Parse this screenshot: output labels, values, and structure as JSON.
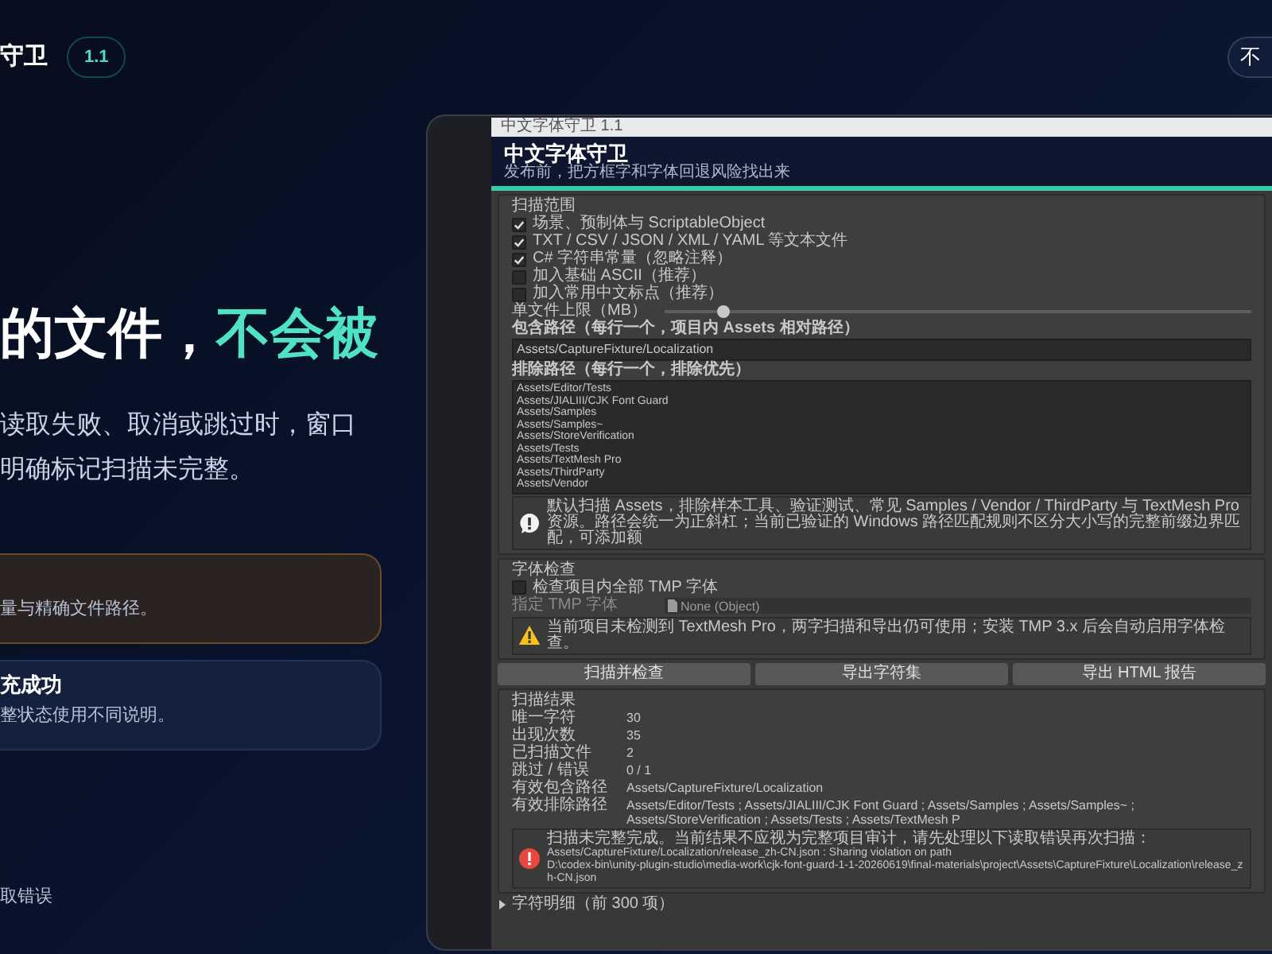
{
  "brand": {
    "title": "守卫",
    "version": "1.1"
  },
  "nav_button": {
    "label": "不"
  },
  "hero": {
    "heading_white": "的文件，",
    "heading_accent": "不会被",
    "lines": [
      "读取失败、取消或跳过时，窗口",
      "明确标记扫描未完整。"
    ]
  },
  "cards": [
    {
      "kind": "warning",
      "text": "量与精确文件路径。"
    },
    {
      "kind": "success",
      "title": "充成功",
      "text": "整状态使用不同说明。"
    }
  ],
  "footer_text": "取错误",
  "app": {
    "window_title": "中文字体守卫 1.1",
    "header": {
      "title": "中文字体守卫",
      "subtitle": "发布前，把方框字和字体回退风险找出来"
    },
    "scan_scope": {
      "title": "扫描范围",
      "options": [
        {
          "label": "场景、预制体与 ScriptableObject",
          "checked": true
        },
        {
          "label": "TXT / CSV / JSON / XML / YAML 等文本文件",
          "checked": true
        },
        {
          "label": "C# 字符串常量（忽略注释）",
          "checked": true
        },
        {
          "label": "加入基础 ASCII（推荐）",
          "checked": false
        },
        {
          "label": "加入常用中文标点（推荐）",
          "checked": false
        }
      ],
      "slider": {
        "label": "单文件上限（MB）",
        "level": 0.1
      },
      "include": {
        "label": "包含路径（每行一个，项目内 Assets 相对路径）",
        "lines": [
          "Assets/CaptureFixture/Localization"
        ]
      },
      "exclude": {
        "label": "排除路径（每行一个，排除优先）",
        "lines": [
          "Assets/Editor/Tests",
          "Assets/JIALIII/CJK Font Guard",
          "Assets/Samples",
          "Assets/Samples~",
          "Assets/StoreVerification",
          "Assets/Tests",
          "Assets/TextMesh Pro",
          "Assets/ThirdParty",
          "Assets/Vendor"
        ]
      },
      "note": {
        "kind": "info",
        "text": "默认扫描 Assets，排除样本工具、验证测试、常见 Samples / Vendor / ThirdParty 与 TextMesh Pro 资源。路径会统一为正斜杠；当前已验证的 Windows 路径匹配规则不区分大小写的完整前缀边界匹配，可添加额"
      }
    },
    "font_check": {
      "title": "字体检查",
      "option": {
        "label": "检查项目内全部 TMP 字体",
        "checked": false
      },
      "field": {
        "label": "指定 TMP 字体",
        "value": "None (Object)",
        "disabled": true
      },
      "note": {
        "kind": "warning",
        "text": "当前项目未检测到 TextMesh Pro，两字扫描和导出仍可使用；安装 TMP 3.x 后会自动启用字体检查。"
      }
    },
    "buttons": [
      "扫描并检查",
      "导出字符集",
      "导出 HTML 报告"
    ],
    "results": {
      "title": "扫描结果",
      "rows": [
        {
          "label": "唯一字符",
          "value": "30"
        },
        {
          "label": "出现次数",
          "value": "35"
        },
        {
          "label": "已扫描文件",
          "value": "2"
        },
        {
          "label": "跳过 / 错误",
          "value": "0 / 1"
        },
        {
          "label": "有效包含路径",
          "value": "Assets/CaptureFixture/Localization"
        },
        {
          "label": "有效排除路径",
          "value": "Assets/Editor/Tests ; Assets/JIALIII/CJK Font Guard ; Assets/Samples ; Assets/Samples~ ; Assets/StoreVerification ; Assets/Tests ; Assets/TextMesh P"
        }
      ],
      "note": {
        "kind": "error",
        "lines": [
          "扫描未完整完成。当前结果不应视为完整项目审计，请先处理以下读取错误再次扫描：",
          "Assets/CaptureFixture/Localization/release_zh-CN.json : Sharing violation on path",
          "D:\\codex-bin\\unity-plugin-studio\\media-work\\cjk-font-guard-1-1-20260619\\final-materials\\project\\Assets\\CaptureFixture\\Localization\\release_zh-CN.json"
        ]
      }
    },
    "details": {
      "label": "字符明细（前 300 项）",
      "expanded": false
    }
  }
}
